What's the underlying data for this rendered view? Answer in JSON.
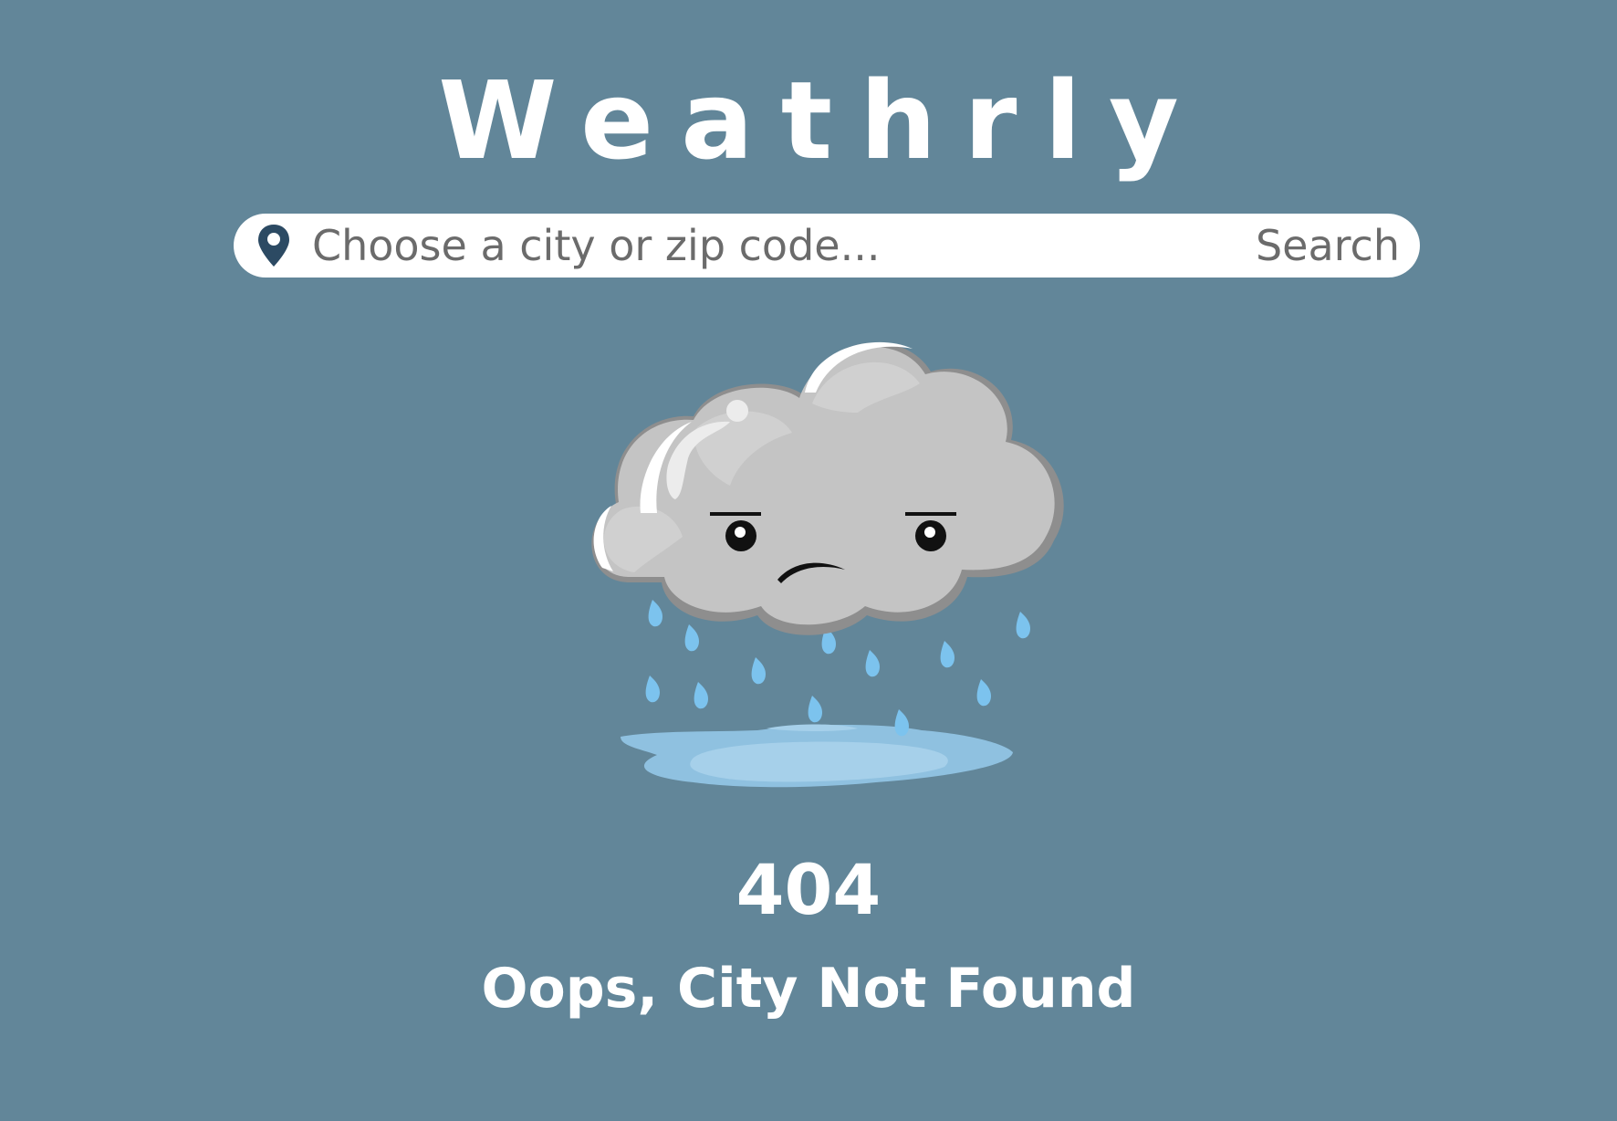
{
  "app": {
    "title": "Weathrly"
  },
  "search": {
    "placeholder": "Choose a city or zip code...",
    "button_label": "Search",
    "pin_icon": "map-pin-icon"
  },
  "error": {
    "code": "404",
    "message": "Oops, City Not Found",
    "illustration": "sad-rain-cloud-icon"
  },
  "colors": {
    "background": "#628699",
    "text": "#ffffff",
    "search_bg": "#ffffff",
    "search_text": "#6b6b6b",
    "pin": "#2c4a63",
    "rain": "#7cc3ee",
    "puddle": "#a6d0ea"
  }
}
